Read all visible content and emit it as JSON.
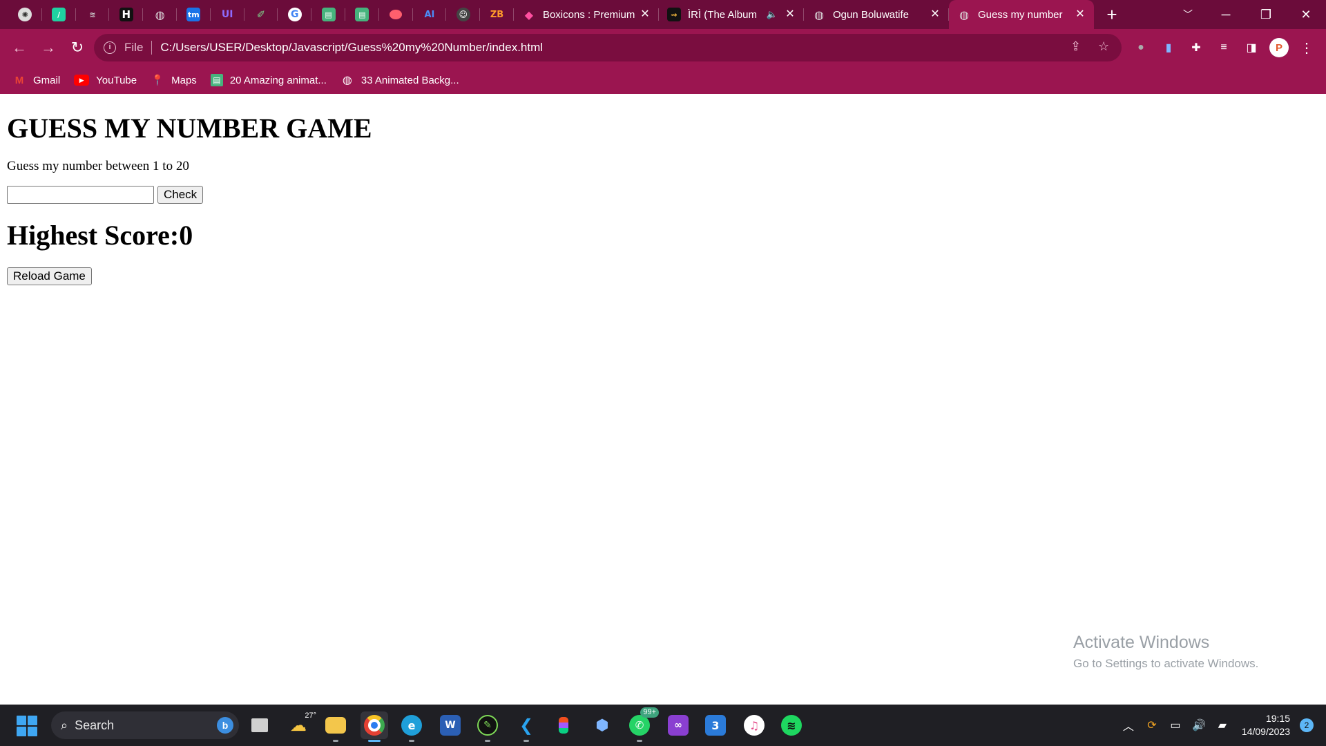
{
  "browser": {
    "tabs": [
      {
        "title": "Boxicons : Premium",
        "favicon": "boxicons-icon"
      },
      {
        "title": "ÌRÌ (The Album",
        "favicon": "album-icon"
      },
      {
        "title": "Ogun Boluwatife",
        "favicon": "globe-icon"
      },
      {
        "title": "Guess my number",
        "favicon": "globe-icon",
        "active": true
      }
    ],
    "new_tab_label": "+",
    "address": {
      "scheme_label": "File",
      "url": "C:/Users/USER/Desktop/Javascript/Guess%20my%20Number/index.html"
    },
    "profile_initial": "P",
    "bookmarks": [
      {
        "label": "Gmail",
        "icon": "gmail-icon"
      },
      {
        "label": "YouTube",
        "icon": "youtube-icon"
      },
      {
        "label": "Maps",
        "icon": "maps-icon"
      },
      {
        "label": "20 Amazing animat...",
        "icon": "bookmark-icon"
      },
      {
        "label": "33 Animated Backg...",
        "icon": "globe-icon"
      }
    ]
  },
  "page": {
    "title": "GUESS MY NUMBER GAME",
    "instruction": "Guess my number between 1 to 20",
    "guess_value": "",
    "check_label": "Check",
    "highest_score": "Highest Score:0",
    "reload_label": "Reload Game"
  },
  "watermark": {
    "line1": "Activate Windows",
    "line2": "Go to Settings to activate Windows."
  },
  "taskbar": {
    "search_label": "Search",
    "weather_temp": "27°",
    "whatsapp_badge": "99+",
    "clock_time": "19:15",
    "clock_date": "14/09/2023",
    "notification_count": "2"
  },
  "colors": {
    "tabstrip": "#6b0c3a",
    "toolbar": "#9b1550",
    "omnibox": "#7a0d3f",
    "taskbar": "#1f1f24"
  }
}
